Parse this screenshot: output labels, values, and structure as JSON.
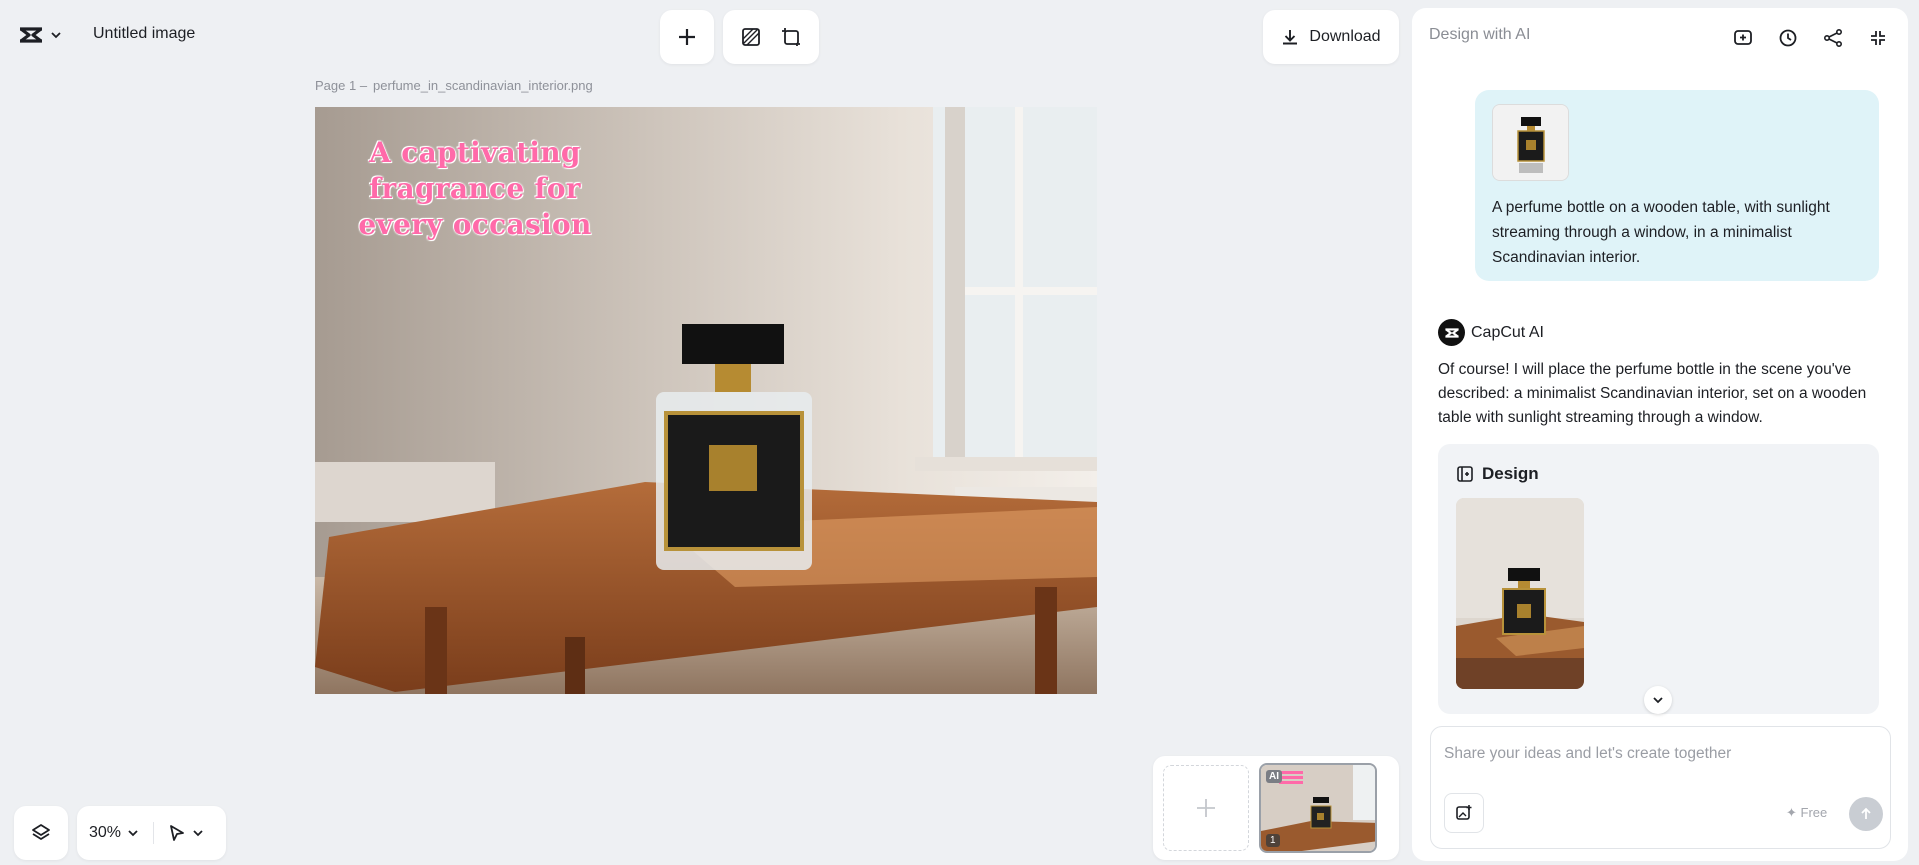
{
  "header": {
    "logo_icon": "capcut-logo-icon",
    "document_title": "Untitled image",
    "download_label": "Download"
  },
  "toolbar": {
    "add_icon": "plus-icon",
    "tools": [
      "background-removal-icon",
      "resize-icon"
    ]
  },
  "canvas": {
    "page_label": "Page 1 –",
    "file_name": "perfume_in_scandinavian_interior.png",
    "headline_lines": [
      "A captivating",
      "fragrance for",
      "every occasion"
    ]
  },
  "bottom_controls": {
    "zoom": "30%",
    "layers_icon": "layers-icon",
    "pointer_icon": "pointer-icon"
  },
  "pages": {
    "add_icon": "plus-icon",
    "thumb_badge": "AI",
    "thumb_number": "1"
  },
  "panel": {
    "title": "Design with AI",
    "actions": [
      "new-chat-icon",
      "history-icon",
      "share-icon",
      "collapse-icon"
    ],
    "user_message": "A perfume bottle on a wooden table, with sunlight streaming through a window, in a minimalist Scandinavian interior.",
    "ai_name": "CapCut AI",
    "ai_message": "Of course! I will place the perfume bottle in the scene you've described: a minimalist Scandinavian interior, set on a wooden table with sunlight streaming through a window.",
    "design_label": "Design",
    "input_placeholder": "Share your ideas and let's create together",
    "free_label": "✦ Free"
  },
  "colors": {
    "background": "#eef0f3",
    "user_bubble": "#dff3f8",
    "headline_pink": "#ff6aa9"
  }
}
